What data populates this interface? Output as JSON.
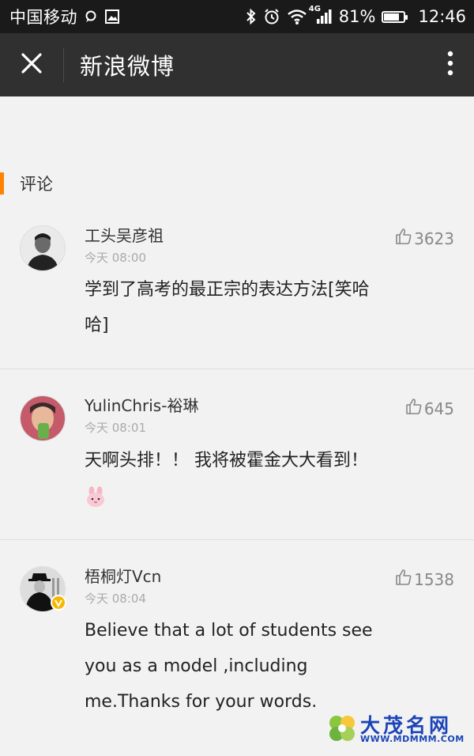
{
  "status_bar": {
    "carrier": "中国移动",
    "network_badge": "4G",
    "battery_percent": "81%",
    "battery_level": 0.81,
    "time": "12:46",
    "icons": [
      "message-icon",
      "image-icon",
      "bluetooth-icon",
      "alarm-icon",
      "wifi-icon",
      "signal-icon",
      "battery-icon"
    ]
  },
  "title_bar": {
    "title": "新浪微博",
    "close_icon": "close-icon",
    "more_icon": "more-vertical-icon"
  },
  "section": {
    "title": "评论",
    "accent_color": "#ff8200"
  },
  "comments": [
    {
      "username": "工头吴彦祖",
      "time": "今天 08:00",
      "likes": "3623",
      "text": "学到了高考的最正宗的表达方法[笑哈哈]"
    },
    {
      "username": "YulinChris-裕琳",
      "time": "今天 08:01",
      "likes": "645",
      "text": "天啊头排！！ 我将被霍金大大看到！",
      "emoji": "rabbit-emoji-icon"
    },
    {
      "username": "梧桐灯Vcn",
      "time": "今天 08:04",
      "likes": "1538",
      "text": "Believe that a lot of students see you as a model ,including me.Thanks for your words.",
      "verified": true
    }
  ],
  "watermark": {
    "name": "大茂名网",
    "url": "WWW.MDMMM.COM"
  }
}
